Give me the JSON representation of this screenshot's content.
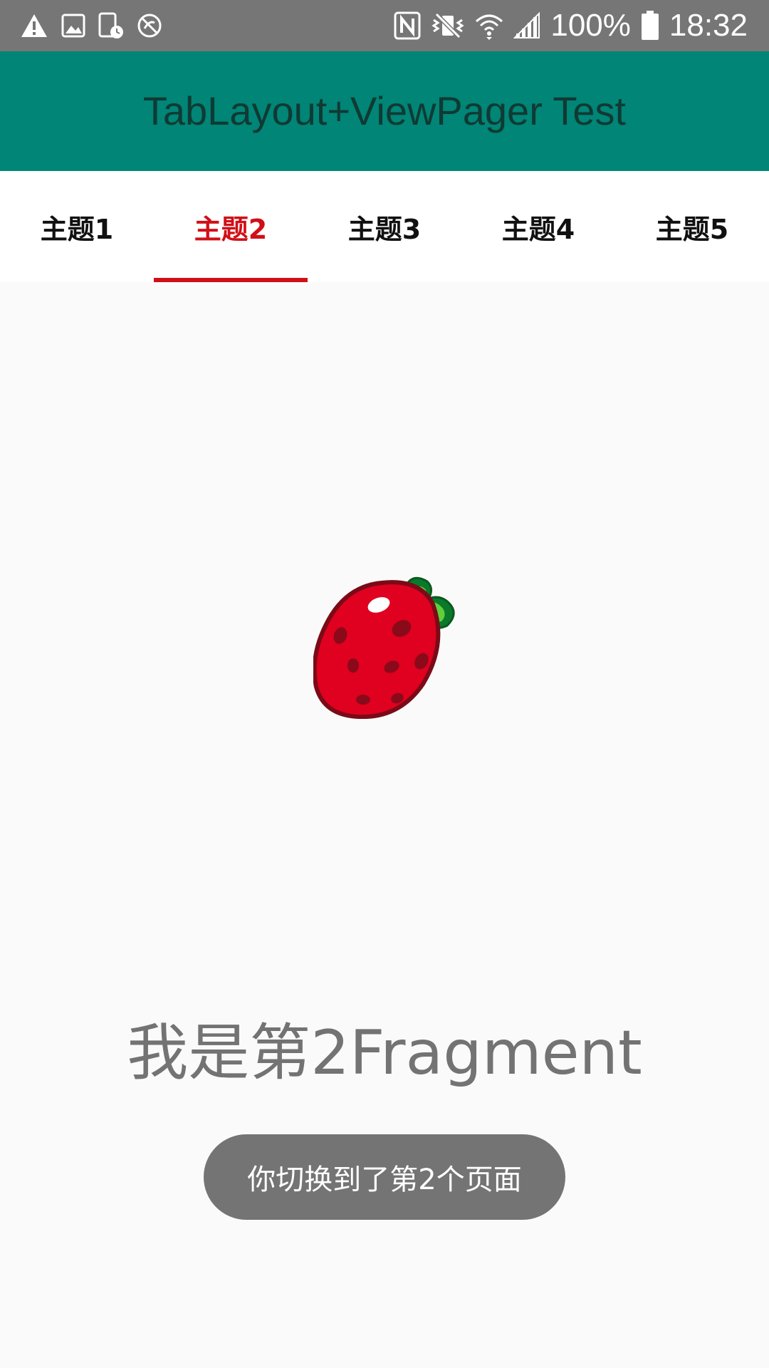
{
  "status_bar": {
    "left_icons": [
      "warning-icon",
      "image-icon",
      "screen-schedule-icon",
      "blocked-icon"
    ],
    "right_icons": [
      "nfc-icon",
      "vibrate-icon",
      "wifi-icon",
      "signal-icon",
      "battery-icon"
    ],
    "battery_percent": "100%",
    "time": "18:32"
  },
  "app_bar": {
    "title": "TabLayout+ViewPager Test",
    "background": "#008577"
  },
  "tabs": {
    "items": [
      {
        "label": "主题1"
      },
      {
        "label": "主题2"
      },
      {
        "label": "主题3"
      },
      {
        "label": "主题4"
      },
      {
        "label": "主题5"
      }
    ],
    "selected_index": 1,
    "selected_color": "#d10f17"
  },
  "content": {
    "image_icon": "strawberry-icon",
    "fragment_text": "我是第2Fragment",
    "toast_text": "你切换到了第2个页面"
  }
}
